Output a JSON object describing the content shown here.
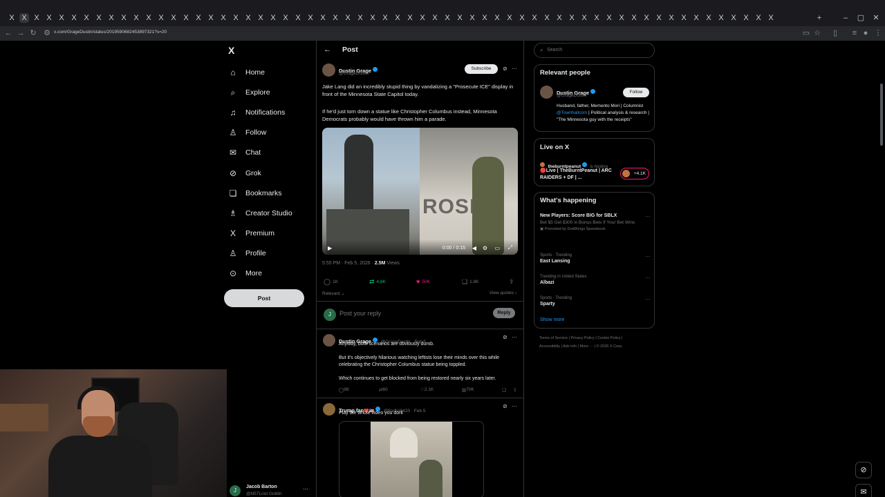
{
  "browser": {
    "url": "x.com/GrageDustin/status/2019590682453897321?s=20",
    "tab_glyph": "X",
    "new_tab": "+",
    "window_controls": [
      "–",
      "▢",
      "✕"
    ]
  },
  "nav": {
    "logo": "X",
    "items": [
      {
        "label": "Home",
        "icon": "home-icon",
        "glyph": "⌂"
      },
      {
        "label": "Explore",
        "icon": "search-icon",
        "glyph": "⌕"
      },
      {
        "label": "Notifications",
        "icon": "bell-icon",
        "glyph": "♫"
      },
      {
        "label": "Follow",
        "icon": "person-add-icon",
        "glyph": "♙"
      },
      {
        "label": "Chat",
        "icon": "mail-icon",
        "glyph": "✉"
      },
      {
        "label": "Grok",
        "icon": "grok-icon",
        "glyph": "⊘"
      },
      {
        "label": "Bookmarks",
        "icon": "bookmark-icon",
        "glyph": "❏"
      },
      {
        "label": "Creator Studio",
        "icon": "creator-icon",
        "glyph": "♗"
      },
      {
        "label": "Premium",
        "icon": "x-logo-icon",
        "glyph": "X"
      },
      {
        "label": "Profile",
        "icon": "profile-icon",
        "glyph": "♙"
      },
      {
        "label": "More",
        "icon": "more-icon",
        "glyph": "⊙"
      }
    ],
    "post_label": "Post",
    "account": {
      "name": "Jacob Barton",
      "handle": "@N57Lnot Goblin",
      "initial": "J"
    }
  },
  "center": {
    "header_title": "Post",
    "back_glyph": "←",
    "post": {
      "author": "Dustin Grage",
      "handle": "@GrageDustin",
      "subscribe_label": "Subscribe",
      "text1": "Jake Lang did an incredibly stupid thing by vandalizing a \"Prosecute ICE\" display in front of the Minnesota State Capitol today.",
      "text2": "If he'd just torn down a statue like Christopher Columbus instead, Minnesota Democrats probably would have thrown him a parade.",
      "video_time": "0:00 / 0:15",
      "video_text": "ROSE",
      "time": "5:55 PM · Feb 5, 2026 · ",
      "views": "2.5M",
      "views_label": " Views",
      "stats": {
        "replies": "1K",
        "reposts": "4.8K",
        "likes": "50K",
        "bookmarks": "1.8K"
      },
      "sort_label": "Relevant ⌄",
      "view_quotes": "View quotes ›"
    },
    "composer": {
      "initial": "J",
      "placeholder": "Post your reply",
      "reply_label": "Reply"
    },
    "replies": [
      {
        "author": "Dustin Grage",
        "handle": "@GrageDustin · Feb 5",
        "paragraphs": [
          "Anyway, both scenarios are obviously dumb.",
          "But it's objectively hilarious watching leftists lose their minds over this while celebrating the Christopher Columbus statue being toppled.",
          "Which continues to get blocked from being restored nearly six years later."
        ],
        "stats": {
          "replies": "98",
          "reposts": "60",
          "likes": "2.1K",
          "views": "70K"
        }
      },
      {
        "author": "Trump fan",
        "author_badges": "❤️🇺🇸",
        "handle": "@firefist0420 · Feb 5",
        "paragraphs": [
          "Play the whole video you dork"
        ]
      }
    ]
  },
  "right": {
    "search_placeholder": "Search",
    "relevant": {
      "title": "Relevant people",
      "name": "Dustin Grage",
      "handle": "@GrageDustin",
      "follow_label": "Follow",
      "bio_pre": "Husband, father, Memento Mori | Columnist ",
      "bio_link": "@Townhallcom",
      "bio_post": " | Political analysis & research | \"The Minnesota guy with the receipts\""
    },
    "live": {
      "title": "Live on X",
      "host": "theburntpeanut",
      "host_status": "is hosting",
      "stream_title": "🔴Live | TheBurntPeanut | ARC RAIDERS + DF | ...",
      "viewers": "+4.1K"
    },
    "happening": {
      "title": "What's happening",
      "promo": {
        "title": "New Players: Score BIG for SBLX",
        "desc": "Bet $5 Get $300 in Bonus Bets If Your Bet Wins",
        "promoted": "Promoted by DraftKings Sportsbook"
      },
      "trends": [
        {
          "meta": "Sports · Trending",
          "topic": "East Lansing"
        },
        {
          "meta": "Trending in United States",
          "topic": "Albazi"
        },
        {
          "meta": "Sports · Trending",
          "topic": "Sparty"
        }
      ],
      "show_more": "Show more"
    },
    "footer": {
      "line1": "Terms of Service  |  Privacy Policy  |  Cookie Policy  |",
      "line2": "Accessibility  |  Ads info  |  More ···  |  © 2026 X Corp."
    }
  },
  "colors": {
    "accent": "#1d9bf0",
    "like": "#f91880",
    "repost": "#00ba7c",
    "muted": "#71767b"
  }
}
